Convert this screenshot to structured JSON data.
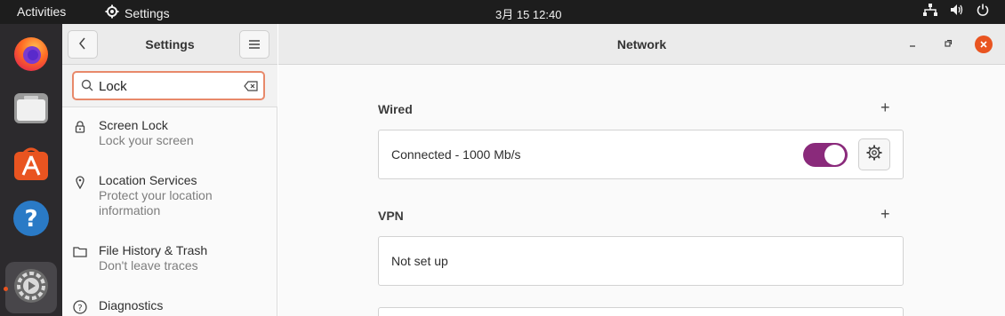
{
  "topbar": {
    "activities": "Activities",
    "app_name": "Settings",
    "clock": "3月 15  12:40",
    "tray_icons": [
      "network-wired-icon",
      "volume-icon",
      "power-icon"
    ]
  },
  "dock": {
    "items": [
      {
        "name": "Firefox",
        "icon": "firefox-icon"
      },
      {
        "name": "Files",
        "icon": "files-icon"
      },
      {
        "name": "Ubuntu Software",
        "icon": "software-store-icon"
      },
      {
        "name": "Help",
        "icon": "help-icon"
      },
      {
        "name": "Settings",
        "icon": "settings-icon",
        "active": true
      }
    ]
  },
  "sidebar": {
    "title": "Settings",
    "search": {
      "value": "Lock",
      "placeholder": ""
    },
    "results": [
      {
        "title": "Screen Lock",
        "subtitle": "Lock your screen",
        "icon": "lock-icon"
      },
      {
        "title": "Location Services",
        "subtitle": "Protect your location information",
        "icon": "location-pin-icon"
      },
      {
        "title": "File History & Trash",
        "subtitle": "Don't leave traces",
        "icon": "folder-icon"
      },
      {
        "title": "Diagnostics",
        "subtitle": "",
        "icon": "help-circle-icon"
      }
    ]
  },
  "main": {
    "title": "Network",
    "wired": {
      "title": "Wired",
      "add_label": "+",
      "connection": "Connected - 1000 Mb/s",
      "enabled": true
    },
    "vpn": {
      "title": "VPN",
      "add_label": "+",
      "status": "Not set up"
    }
  },
  "colors": {
    "accent": "#e95420",
    "toggle_on": "#8a2a7b",
    "topbar": "#1d1d1d",
    "dock": "#2c2a2d"
  }
}
